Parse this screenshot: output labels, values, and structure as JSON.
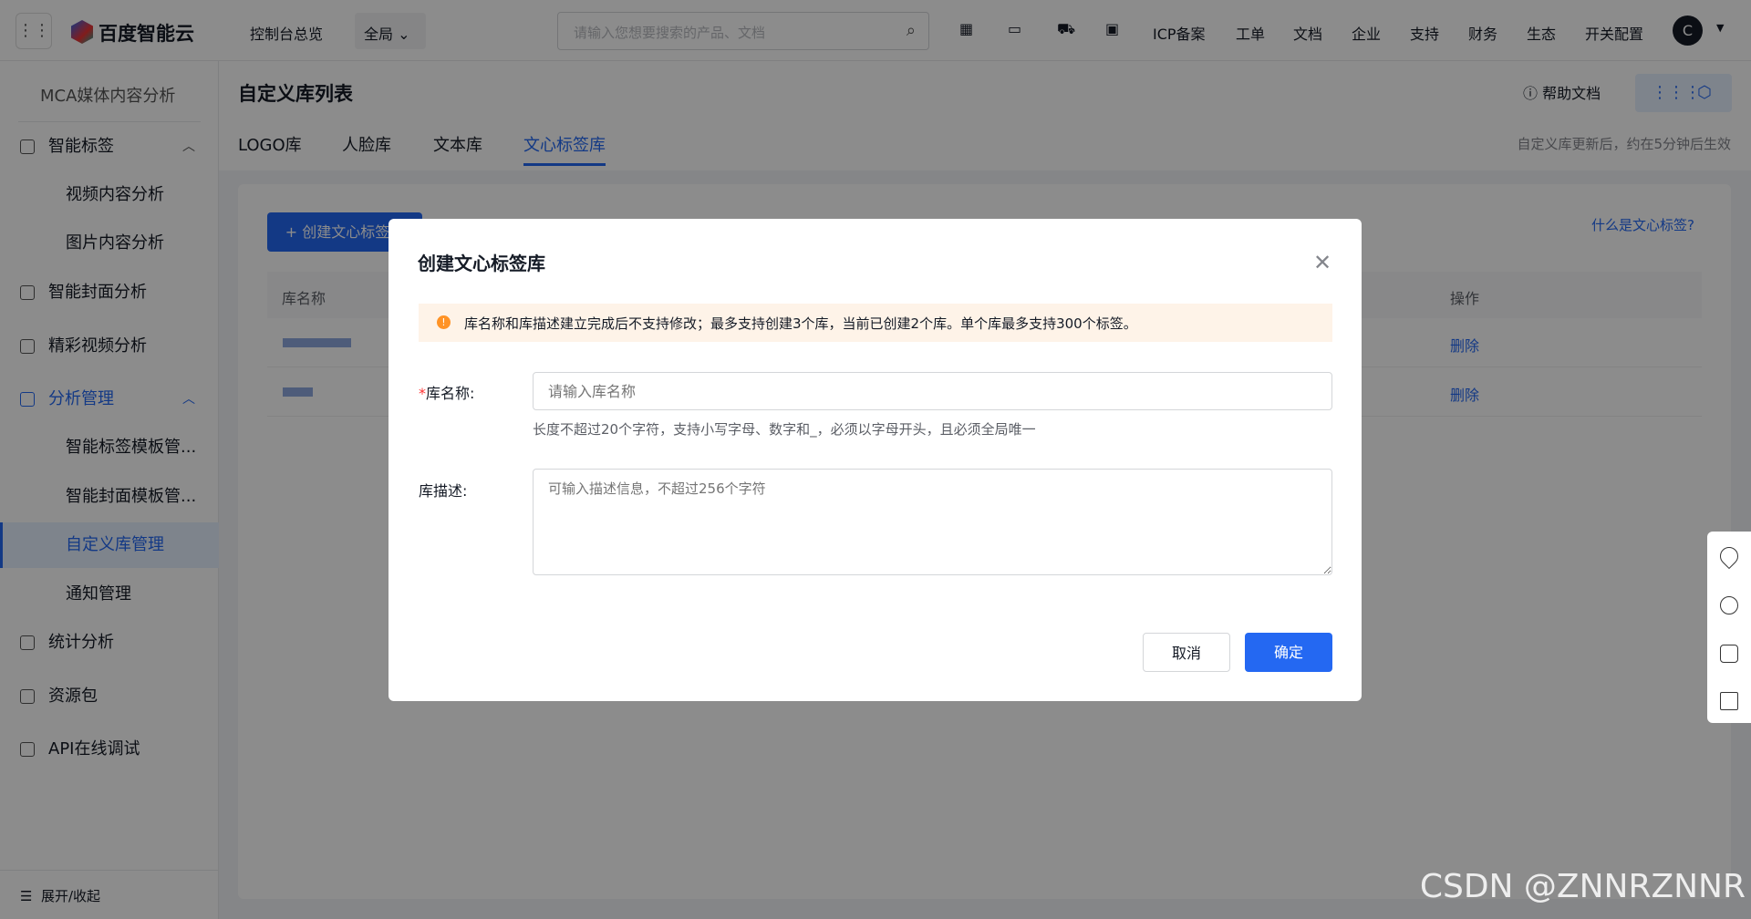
{
  "topbar": {
    "brand": "百度智能云",
    "console": "控制台总览",
    "region": "全局",
    "search_placeholder": "请输入您想要搜索的产品、文档",
    "links": [
      "ICP备案",
      "工单",
      "文档",
      "企业",
      "支持",
      "财务",
      "生态",
      "开关配置"
    ],
    "avatar": "C"
  },
  "sidebar": {
    "title": "MCA媒体内容分析",
    "items": [
      {
        "label": "智能标签",
        "type": "group"
      },
      {
        "label": "视频内容分析",
        "type": "sub"
      },
      {
        "label": "图片内容分析",
        "type": "sub"
      },
      {
        "label": "智能封面分析",
        "type": "item"
      },
      {
        "label": "精彩视频分析",
        "type": "item"
      },
      {
        "label": "分析管理",
        "type": "group"
      },
      {
        "label": "智能标签模板管...",
        "type": "sub"
      },
      {
        "label": "智能封面模板管...",
        "type": "sub"
      },
      {
        "label": "自定义库管理",
        "type": "sub"
      },
      {
        "label": "通知管理",
        "type": "sub"
      },
      {
        "label": "统计分析",
        "type": "item"
      },
      {
        "label": "资源包",
        "type": "item"
      },
      {
        "label": "API在线调试",
        "type": "item"
      }
    ],
    "collapse": "展开/收起"
  },
  "page": {
    "title": "自定义库列表",
    "help": "帮助文档",
    "tabs": [
      "LOGO库",
      "人脸库",
      "文本库",
      "文心标签库"
    ],
    "active_tab": 3,
    "notice": "自定义库更新后，约在5分钟后生效",
    "create_button": "+ 创建文心标签库",
    "what_link": "什么是文心标签?",
    "table": {
      "headers": [
        "库名称",
        "操作"
      ],
      "rows": [
        {
          "action": "删除"
        },
        {
          "action": "删除"
        }
      ]
    }
  },
  "modal": {
    "title": "创建文心标签库",
    "alert": "库名称和库描述建立完成后不支持修改；最多支持创建3个库，当前已创建2个库。单个库最多支持300个标签。",
    "name_label": "库名称:",
    "name_required": "*",
    "name_placeholder": "请输入库名称",
    "name_hint": "长度不超过20个字符，支持小写字母、数字和_，必须以字母开头，且必须全局唯一",
    "desc_label": "库描述:",
    "desc_placeholder": "可输入描述信息，不超过256个字符",
    "cancel": "取消",
    "ok": "确定"
  },
  "watermark": "CSDN @ZNNRZNNR",
  "colors": {
    "primary": "#2468f2",
    "alert_bg": "#fef3e8",
    "warning": "#ff9326"
  }
}
